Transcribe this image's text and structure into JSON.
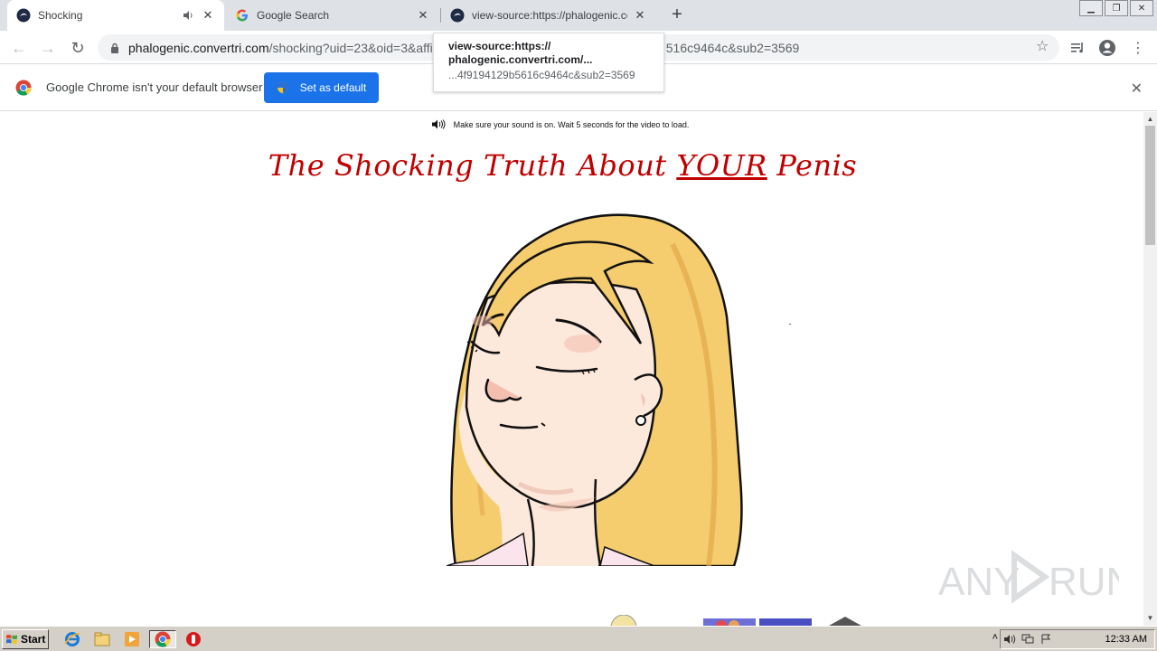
{
  "browser": {
    "tabs": [
      {
        "title": "Shocking",
        "active": true,
        "audio": true
      },
      {
        "title": "Google Search",
        "active": false,
        "audio": false
      },
      {
        "title": "view-source:https://phalogenic.conv",
        "active": false,
        "audio": false
      }
    ],
    "address": {
      "host": "phalogenic.convertri.com",
      "path": "/shocking?uid=23&oid=3&affi",
      "tail": "516c9464c&sub2=3569"
    },
    "tooltip": {
      "line1": "view-source:https://",
      "line2": "phalogenic.convertri.com/...",
      "line3": "...4f9194129b5616c9464c&sub2=3569"
    },
    "infobar": {
      "message": "Google Chrome isn't your default browser",
      "button": "Set as default"
    }
  },
  "page": {
    "sound_note": "Make sure your sound is on. Wait 5 seconds for the video to load.",
    "headline": {
      "before": "The Shocking Truth About ",
      "emphasis": "YOUR",
      "after": " Penis"
    }
  },
  "watermark": "ANY RUN",
  "taskbar": {
    "start_label": "Start",
    "clock": "12:33 AM"
  },
  "colors": {
    "headline": "#c00000",
    "accent_button": "#1a73e8",
    "hair": "#f5cd6e",
    "skin": "#fde8dc"
  }
}
